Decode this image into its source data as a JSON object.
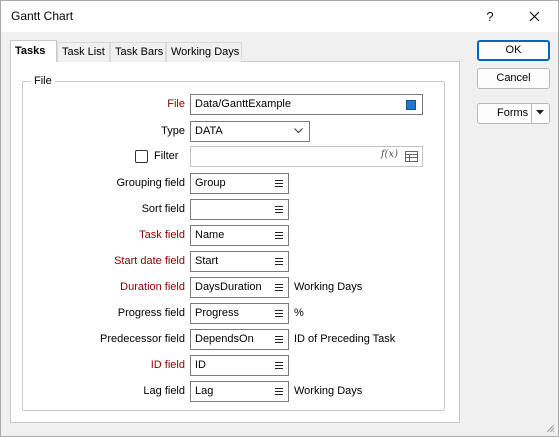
{
  "window": {
    "title": "Gantt Chart",
    "help_glyph": "?",
    "close_glyph": "×"
  },
  "tabs": [
    "Tasks",
    "Task List",
    "Task Bars",
    "Working Days"
  ],
  "group": {
    "legend": "File"
  },
  "form": {
    "file": {
      "label": "File",
      "value": "Data/GanttExample"
    },
    "type": {
      "label": "Type",
      "value": "DATA"
    },
    "filter": {
      "label": "Filter",
      "value": "",
      "checked": false
    },
    "grouping_field": {
      "label": "Grouping field",
      "value": "Group"
    },
    "sort_field": {
      "label": "Sort field",
      "value": ""
    },
    "task_field": {
      "label": "Task field",
      "value": "Name"
    },
    "start_date_field": {
      "label": "Start date field",
      "value": "Start"
    },
    "duration_field": {
      "label": "Duration field",
      "value": "DaysDuration",
      "suffix": "Working Days"
    },
    "progress_field": {
      "label": "Progress field",
      "value": "Progress",
      "suffix": "%"
    },
    "predecessor_field": {
      "label": "Predecessor field",
      "value": "DependsOn",
      "suffix": "ID of Preceding Task"
    },
    "id_field": {
      "label": "ID field",
      "value": "ID"
    },
    "lag_field": {
      "label": "Lag field",
      "value": "Lag",
      "suffix": "Working Days"
    }
  },
  "buttons": {
    "ok": "OK",
    "cancel": "Cancel",
    "forms": "Forms"
  },
  "colors": {
    "required_label": "#8b0000",
    "accent": "#0067c0",
    "file_picker": "#1f78c8"
  }
}
